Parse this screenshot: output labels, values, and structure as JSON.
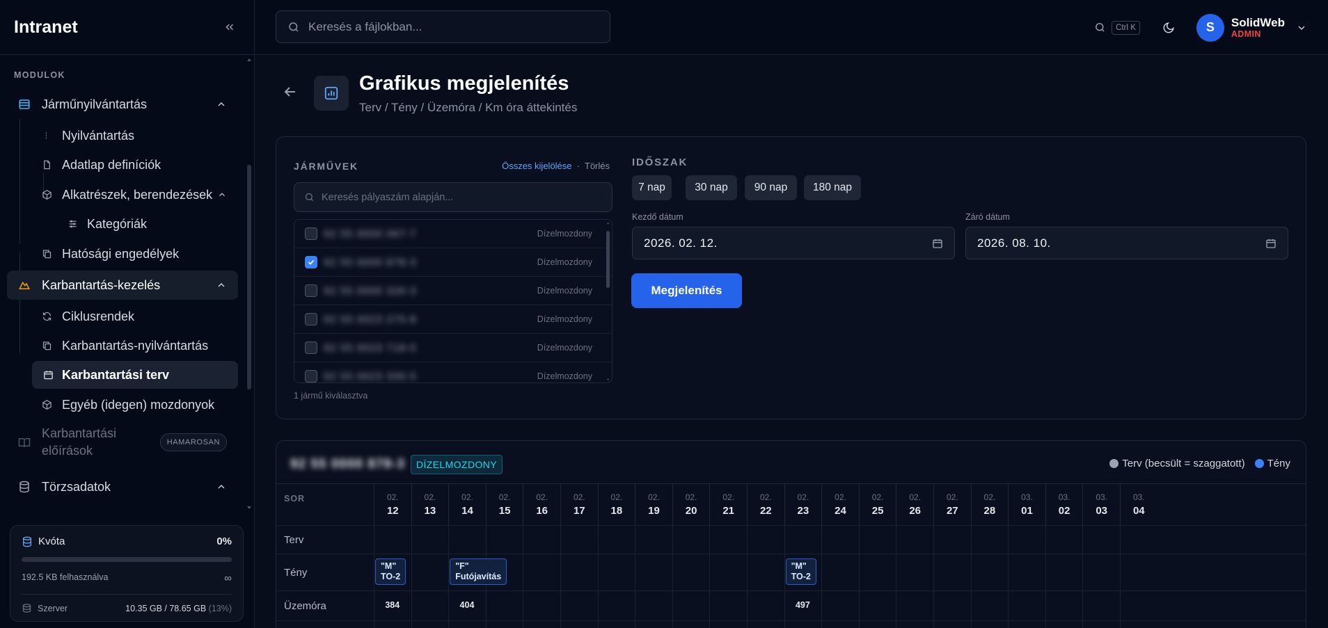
{
  "sidebar": {
    "title": "Intranet",
    "section": "MODULOK",
    "items": [
      {
        "label": "Járműnyilvántartás"
      },
      {
        "label": "Nyilvántartás"
      },
      {
        "label": "Adatlap definíciók"
      },
      {
        "label": "Alkatrészek, berendezések"
      },
      {
        "label": "Kategóriák"
      },
      {
        "label": "Hatósági engedélyek"
      },
      {
        "label": "Karbantartás-kezelés"
      },
      {
        "label": "Ciklusrendek"
      },
      {
        "label": "Karbantartás-nyilvántartás"
      },
      {
        "label": "Karbantartási terv"
      },
      {
        "label": "Egyéb (idegen) mozdonyok"
      },
      {
        "label": "Karbantartási előírások"
      },
      {
        "label": "Törzsadatok"
      }
    ],
    "soon_badge": "HAMAROSAN",
    "quota": {
      "label": "Kvóta",
      "percent_text": "0%",
      "used": "192.5 KB felhasználva",
      "limit_symbol": "∞",
      "server_label": "Szerver",
      "server_value": "10.35 GB / 78.65 GB",
      "server_percent": "(13%)"
    }
  },
  "topbar": {
    "search_placeholder": "Keresés a fájlokban...",
    "shortcut": "Ctrl K",
    "avatar_initial": "S",
    "user_name": "SolidWeb",
    "user_role": "ADMIN"
  },
  "page": {
    "title": "Grafikus megjelenítés",
    "subtitle": "Terv / Tény / Üzemóra / Km óra áttekintés"
  },
  "filter": {
    "vehicles_label": "JÁRMŰVEK",
    "select_all": "Összes kijelölése",
    "dot": "·",
    "clear": "Törlés",
    "search_placeholder": "Keresés pályaszám alapján...",
    "vehicles": [
      {
        "number": "92 55 0000 067-7",
        "type": "Dízelmozdony",
        "checked": false
      },
      {
        "number": "92 55 0000 878-3",
        "type": "Dízelmozdony",
        "checked": true
      },
      {
        "number": "92 55 0000 326-3",
        "type": "Dízelmozdony",
        "checked": false
      },
      {
        "number": "92 55 0023 275-8",
        "type": "Dízelmozdony",
        "checked": false
      },
      {
        "number": "92 55 0023 718-5",
        "type": "Dízelmozdony",
        "checked": false
      },
      {
        "number": "92 55 0023 330-5",
        "type": "Dízelmozdony",
        "checked": false
      }
    ],
    "selected_count": "1 jármű kiválasztva",
    "period_label": "IDŐSZAK",
    "periods": [
      "7 nap",
      "30 nap",
      "90 nap",
      "180 nap"
    ],
    "start_label": "Kezdő dátum",
    "start_value": "2026. 02. 12.",
    "end_label": "Záró dátum",
    "end_value": "2026. 08. 10.",
    "submit": "Megjelenítés"
  },
  "chart": {
    "vehicle": "92 55 0000 878-3",
    "type_badge": "DÍZELMOZDONY",
    "legend": [
      {
        "label": "Terv (becsült = szaggatott)",
        "color": "#9ca3af"
      },
      {
        "label": "Tény",
        "color": "#3b82f6"
      }
    ],
    "row_header": "SOR",
    "rows": [
      "Terv",
      "Tény",
      "Üzemóra"
    ],
    "columns": [
      {
        "m": "02.",
        "d": "12"
      },
      {
        "m": "02.",
        "d": "13"
      },
      {
        "m": "02.",
        "d": "14"
      },
      {
        "m": "02.",
        "d": "15"
      },
      {
        "m": "02.",
        "d": "16"
      },
      {
        "m": "02.",
        "d": "17"
      },
      {
        "m": "02.",
        "d": "18"
      },
      {
        "m": "02.",
        "d": "19"
      },
      {
        "m": "02.",
        "d": "20"
      },
      {
        "m": "02.",
        "d": "21"
      },
      {
        "m": "02.",
        "d": "22"
      },
      {
        "m": "02.",
        "d": "23"
      },
      {
        "m": "02.",
        "d": "24"
      },
      {
        "m": "02.",
        "d": "25"
      },
      {
        "m": "02.",
        "d": "26"
      },
      {
        "m": "02.",
        "d": "27"
      },
      {
        "m": "02.",
        "d": "28"
      },
      {
        "m": "03.",
        "d": "01"
      },
      {
        "m": "03.",
        "d": "02"
      },
      {
        "m": "03.",
        "d": "03"
      },
      {
        "m": "03.",
        "d": "04"
      }
    ],
    "events": [
      {
        "col": 0,
        "line1": "\"M\"",
        "line2": "TO-2"
      },
      {
        "col": 2,
        "line1": "\"F\"",
        "line2": "Futójavítás"
      },
      {
        "col": 11,
        "line1": "\"M\"",
        "line2": "TO-2"
      }
    ],
    "hours": [
      {
        "col": 0,
        "value": "384"
      },
      {
        "col": 2,
        "value": "404"
      },
      {
        "col": 11,
        "value": "497"
      }
    ]
  }
}
